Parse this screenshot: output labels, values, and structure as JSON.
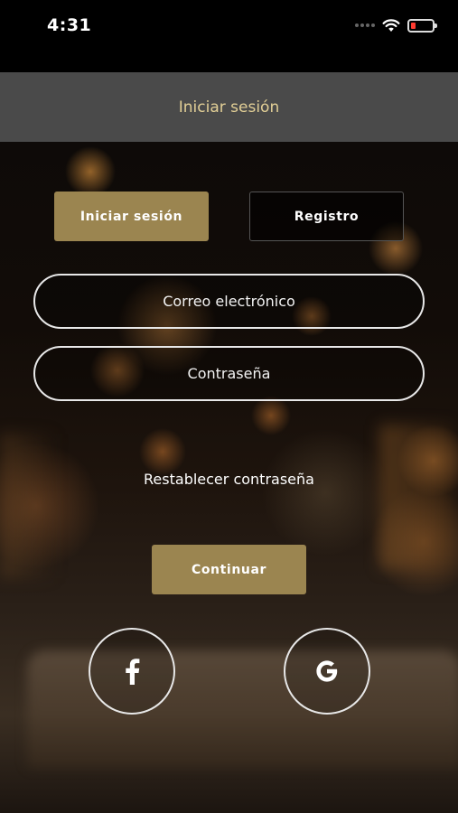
{
  "status_bar": {
    "time": "4:31"
  },
  "header": {
    "title": "Iniciar sesión"
  },
  "tabs": {
    "login_label": "Iniciar sesión",
    "register_label": "Registro",
    "active": "login"
  },
  "form": {
    "email_placeholder": "Correo electrónico",
    "email_value": "",
    "password_placeholder": "Contraseña",
    "password_value": "",
    "reset_password_label": "Restablecer contraseña",
    "continue_label": "Continuar"
  },
  "social": {
    "facebook_icon": "facebook-icon",
    "google_icon": "google-icon"
  },
  "colors": {
    "accent": "#9b8550",
    "header_bg": "#4a4a4a",
    "header_text": "#e2cf96",
    "battery_low": "#ff3b30"
  }
}
